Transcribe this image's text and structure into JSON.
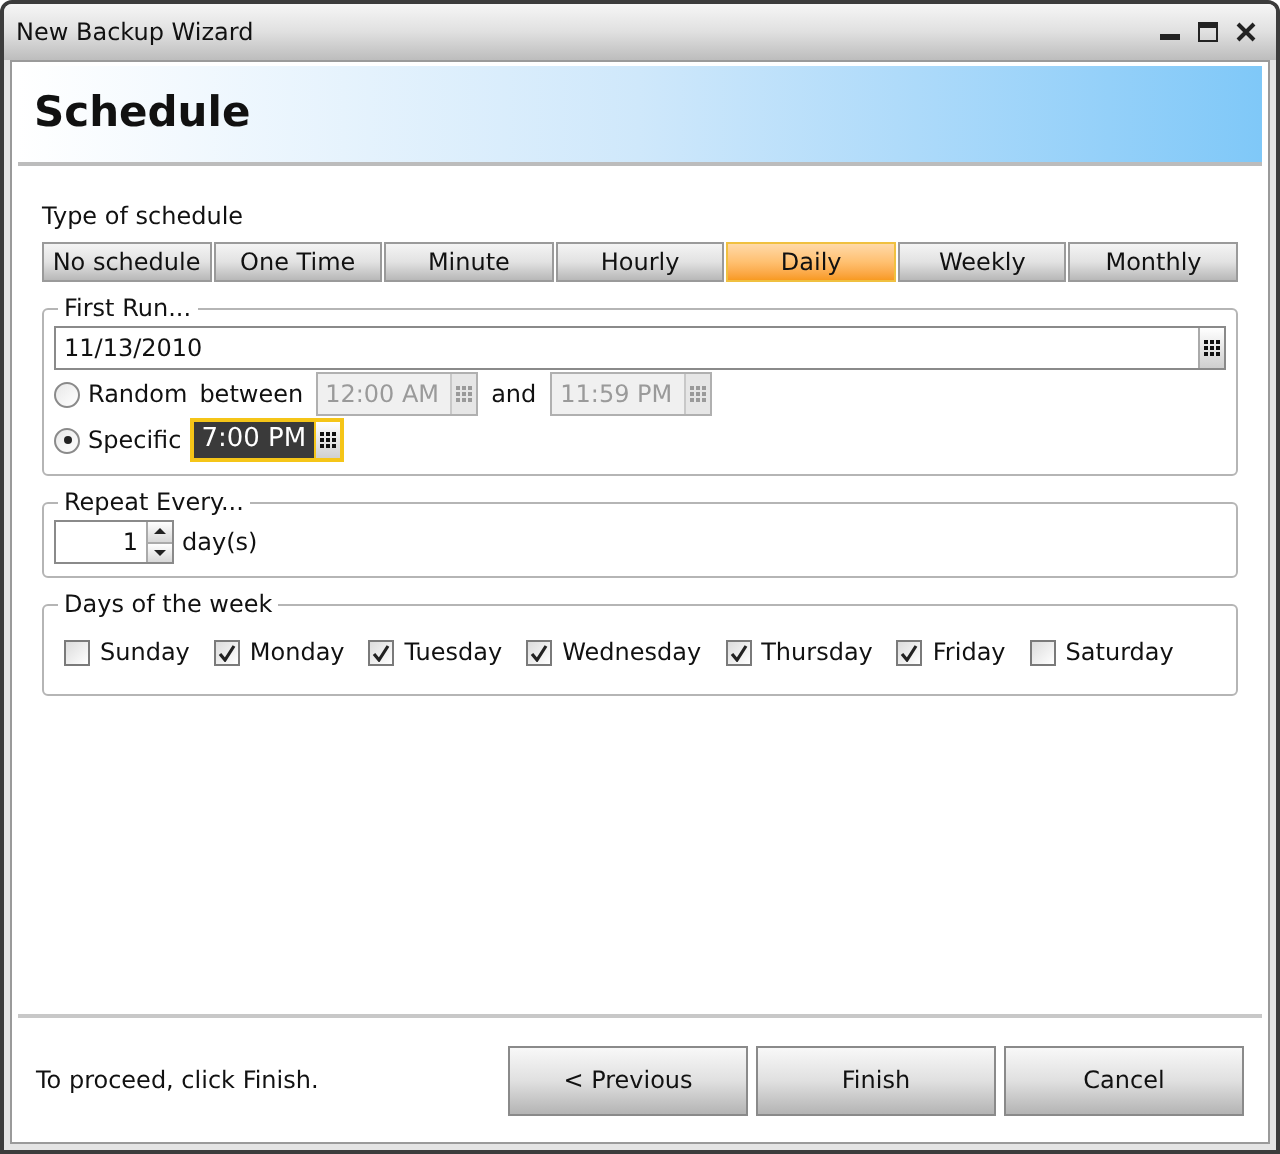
{
  "window": {
    "title": "New Backup Wizard"
  },
  "header": {
    "title": "Schedule"
  },
  "schedule_type": {
    "label": "Type of schedule",
    "options": [
      {
        "label": "No schedule",
        "selected": false
      },
      {
        "label": "One Time",
        "selected": false
      },
      {
        "label": "Minute",
        "selected": false
      },
      {
        "label": "Hourly",
        "selected": false
      },
      {
        "label": "Daily",
        "selected": true
      },
      {
        "label": "Weekly",
        "selected": false
      },
      {
        "label": "Monthly",
        "selected": false
      }
    ]
  },
  "first_run": {
    "legend": "First Run...",
    "date": "11/13/2010",
    "random": {
      "label": "Random",
      "selected": false,
      "between_label": "between",
      "from": "12:00 AM",
      "and_label": "and",
      "to": "11:59 PM"
    },
    "specific": {
      "label": "Specific",
      "selected": true,
      "time": "7:00 PM"
    }
  },
  "repeat": {
    "legend": "Repeat Every...",
    "value": "1",
    "unit": "day(s)"
  },
  "days": {
    "legend": "Days of the week",
    "items": [
      {
        "label": "Sunday",
        "checked": false
      },
      {
        "label": "Monday",
        "checked": true
      },
      {
        "label": "Tuesday",
        "checked": true
      },
      {
        "label": "Wednesday",
        "checked": true
      },
      {
        "label": "Thursday",
        "checked": true
      },
      {
        "label": "Friday",
        "checked": true
      },
      {
        "label": "Saturday",
        "checked": false
      }
    ]
  },
  "footer": {
    "hint": "To proceed, click Finish.",
    "buttons": [
      {
        "label": "< Previous"
      },
      {
        "label": "Finish"
      },
      {
        "label": "Cancel"
      }
    ]
  }
}
